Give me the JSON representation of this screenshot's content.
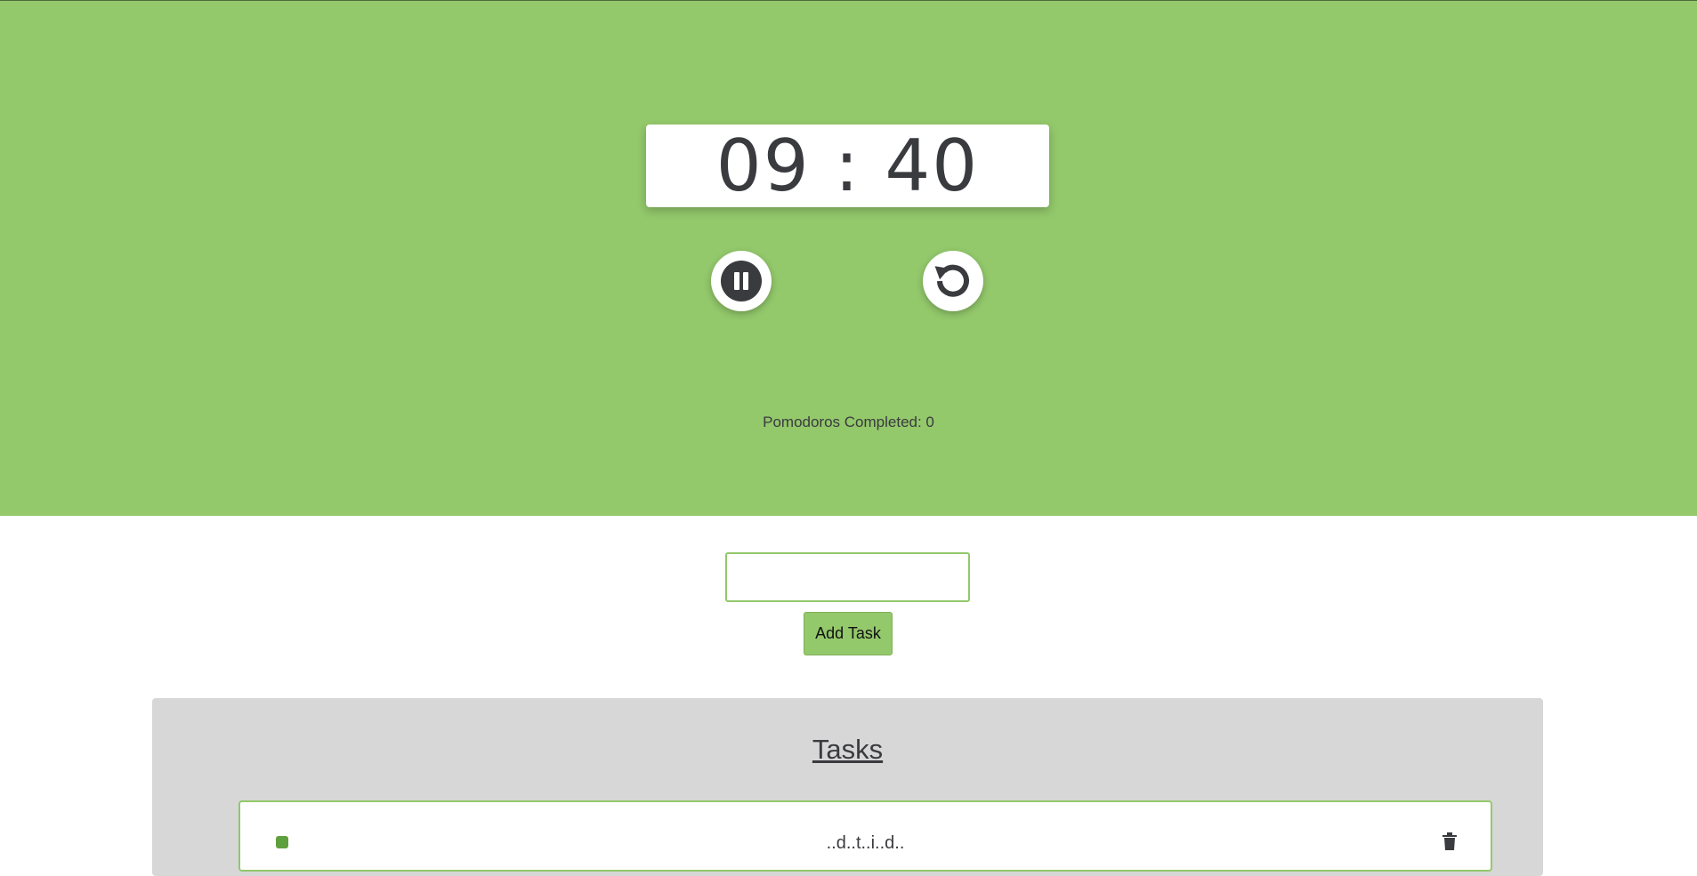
{
  "timer": {
    "display": "09 : 40"
  },
  "controls": {
    "pause_icon": "pause-icon",
    "reset_icon": "reset-icon"
  },
  "stats": {
    "pomodoros_label": "Pomodoros Completed: 0"
  },
  "task_form": {
    "input_value": "",
    "add_label": "Add Task"
  },
  "tasks": {
    "title": "Tasks",
    "items": [
      {
        "text": "..d..t..i..d.."
      }
    ]
  },
  "colors": {
    "accent": "#93c86b",
    "text": "#3a3b3f",
    "panel": "#d7d7d7"
  }
}
